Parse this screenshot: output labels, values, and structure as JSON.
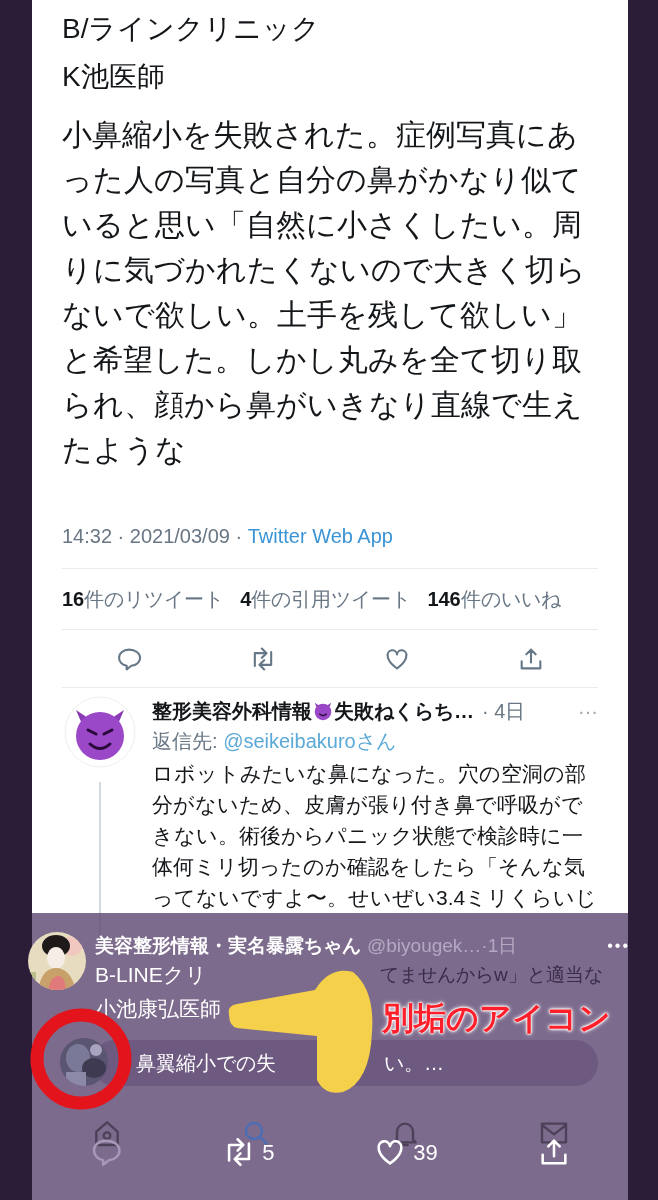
{
  "tweet": {
    "heading_lines": [
      "B/ラインクリニック",
      "K池医師"
    ],
    "body": "小鼻縮小を失敗された。症例写真にあった人の写真と自分の鼻がかなり似ていると思い「自然に小さくしたい。周りに気づかれたくないので大きく切らないで欲しい。土手を残して欲しい」と希望した。しかし丸みを全て切り取られ、顔から鼻がいきなり直線で生えたような",
    "timestamp": "14:32 · 2021/03/09 · ",
    "source": "Twitter Web App",
    "stats": [
      {
        "count": "16",
        "label": "件のリツイート"
      },
      {
        "count": "4",
        "label": "件の引用ツイート"
      },
      {
        "count": "146",
        "label": "件のいいね"
      }
    ],
    "actions": [
      {
        "kind": "reply"
      },
      {
        "kind": "retweet"
      },
      {
        "kind": "like"
      },
      {
        "kind": "share"
      }
    ]
  },
  "reply": {
    "name": "整形美容外科情報",
    "name_rest": "失敗ねくらち…",
    "time": "· 4日",
    "more": "···",
    "reply_to_label": "返信先: ",
    "reply_to_handle": "@seikeibakuroさん",
    "body": "ロボットみたいな鼻になった。穴の空洞の部分がないため、皮膚が張り付き鼻で呼吸ができない。術後からパニック状態で検診時に一体何ミリ切ったのか確認をしたら「そんな気ってないですよ〜。せいぜい3.4ミリくらいじ"
  },
  "overlay_tweet": {
    "name": "美容整形情報・実名暴露ちゃん",
    "handle": "@biyougek…",
    "time": "·1日",
    "more": "•••",
    "lines": [
      "B-LINEクリ",
      "小池康弘医師"
    ],
    "background_text": "てませんからw」と適当な",
    "reply_field": {
      "text_before": "鼻翼縮小での失",
      "text_after": "い。…"
    },
    "tab_bar": [
      {
        "kind": "home",
        "selected": false
      },
      {
        "kind": "search",
        "selected": true
      },
      {
        "kind": "bell",
        "selected": false
      },
      {
        "kind": "mail",
        "selected": false
      }
    ],
    "actions": [
      {
        "kind": "reply"
      },
      {
        "kind": "retweet",
        "count": "5"
      },
      {
        "kind": "like",
        "count": "39"
      },
      {
        "kind": "share"
      }
    ]
  },
  "annotation": {
    "label": "別垢のアイコン"
  }
}
